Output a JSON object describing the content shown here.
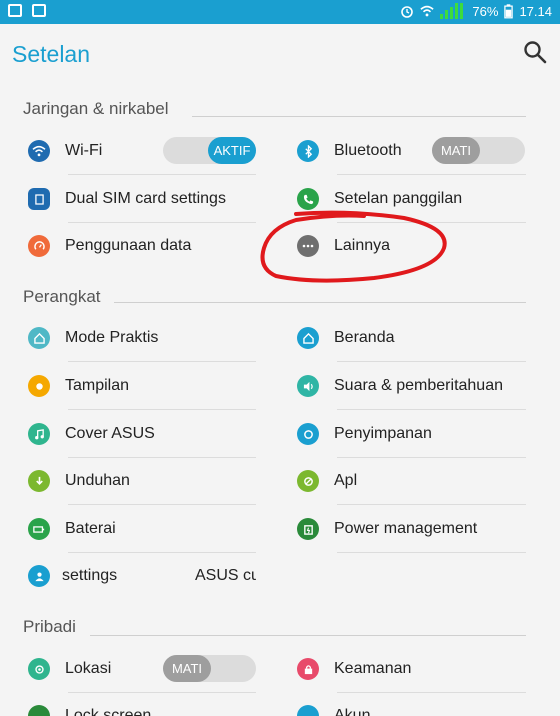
{
  "statusbar": {
    "battery": "76%",
    "time": "17.14"
  },
  "appbar": {
    "title": "Setelan"
  },
  "sections": {
    "network": "Jaringan & nirkabel",
    "device": "Perangkat",
    "personal": "Pribadi"
  },
  "items": {
    "wifi": "Wi-Fi",
    "wifi_toggle": "AKTIF",
    "bluetooth": "Bluetooth",
    "bluetooth_toggle": "MATI",
    "dual_sim": "Dual SIM card settings",
    "call_settings": "Setelan panggilan",
    "data_usage": "Penggunaan data",
    "more": "Lainnya",
    "easy_mode": "Mode Praktis",
    "home": "Beranda",
    "display": "Tampilan",
    "sound": "Suara & pemberitahuan",
    "cover": "Cover ASUS",
    "storage": "Penyimpanan",
    "downloads": "Unduhan",
    "apps": "Apl",
    "battery": "Baterai",
    "power_mgmt": "Power management",
    "custom_settings": "settings",
    "custom_settings_extra": "ASUS cu",
    "location": "Lokasi",
    "location_toggle": "MATI",
    "security": "Keamanan",
    "lock_screen": "Lock screen",
    "accounts": "Akun"
  },
  "colors": {
    "accent": "#1a9fd0",
    "annotation": "#e0191c"
  }
}
